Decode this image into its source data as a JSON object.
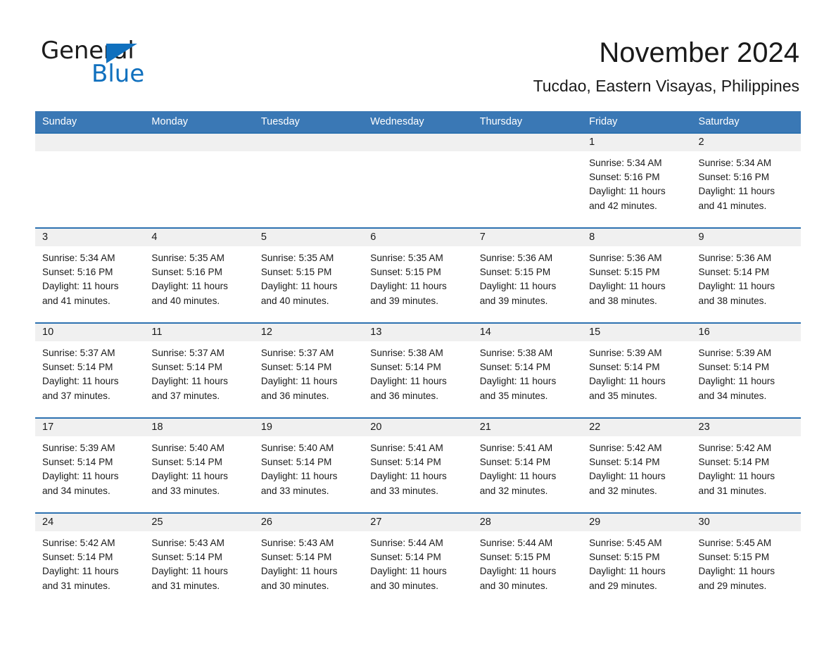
{
  "brand": {
    "name_part1": "General",
    "name_part2": "Blue",
    "logo_icon": "triangle-logo",
    "accent_color": "#1070be"
  },
  "header": {
    "month_title": "November 2024",
    "location": "Tucdao, Eastern Visayas, Philippines"
  },
  "colors": {
    "header_blue": "#3a78b5",
    "row_divider_blue": "#2d72b0",
    "daynum_strip": "#f0f0f0"
  },
  "weekdays": [
    "Sunday",
    "Monday",
    "Tuesday",
    "Wednesday",
    "Thursday",
    "Friday",
    "Saturday"
  ],
  "weeks": [
    [
      {
        "day": "",
        "sunrise": "",
        "sunset": "",
        "daylight1": "",
        "daylight2": ""
      },
      {
        "day": "",
        "sunrise": "",
        "sunset": "",
        "daylight1": "",
        "daylight2": ""
      },
      {
        "day": "",
        "sunrise": "",
        "sunset": "",
        "daylight1": "",
        "daylight2": ""
      },
      {
        "day": "",
        "sunrise": "",
        "sunset": "",
        "daylight1": "",
        "daylight2": ""
      },
      {
        "day": "",
        "sunrise": "",
        "sunset": "",
        "daylight1": "",
        "daylight2": ""
      },
      {
        "day": "1",
        "sunrise": "Sunrise: 5:34 AM",
        "sunset": "Sunset: 5:16 PM",
        "daylight1": "Daylight: 11 hours",
        "daylight2": "and 42 minutes."
      },
      {
        "day": "2",
        "sunrise": "Sunrise: 5:34 AM",
        "sunset": "Sunset: 5:16 PM",
        "daylight1": "Daylight: 11 hours",
        "daylight2": "and 41 minutes."
      }
    ],
    [
      {
        "day": "3",
        "sunrise": "Sunrise: 5:34 AM",
        "sunset": "Sunset: 5:16 PM",
        "daylight1": "Daylight: 11 hours",
        "daylight2": "and 41 minutes."
      },
      {
        "day": "4",
        "sunrise": "Sunrise: 5:35 AM",
        "sunset": "Sunset: 5:16 PM",
        "daylight1": "Daylight: 11 hours",
        "daylight2": "and 40 minutes."
      },
      {
        "day": "5",
        "sunrise": "Sunrise: 5:35 AM",
        "sunset": "Sunset: 5:15 PM",
        "daylight1": "Daylight: 11 hours",
        "daylight2": "and 40 minutes."
      },
      {
        "day": "6",
        "sunrise": "Sunrise: 5:35 AM",
        "sunset": "Sunset: 5:15 PM",
        "daylight1": "Daylight: 11 hours",
        "daylight2": "and 39 minutes."
      },
      {
        "day": "7",
        "sunrise": "Sunrise: 5:36 AM",
        "sunset": "Sunset: 5:15 PM",
        "daylight1": "Daylight: 11 hours",
        "daylight2": "and 39 minutes."
      },
      {
        "day": "8",
        "sunrise": "Sunrise: 5:36 AM",
        "sunset": "Sunset: 5:15 PM",
        "daylight1": "Daylight: 11 hours",
        "daylight2": "and 38 minutes."
      },
      {
        "day": "9",
        "sunrise": "Sunrise: 5:36 AM",
        "sunset": "Sunset: 5:14 PM",
        "daylight1": "Daylight: 11 hours",
        "daylight2": "and 38 minutes."
      }
    ],
    [
      {
        "day": "10",
        "sunrise": "Sunrise: 5:37 AM",
        "sunset": "Sunset: 5:14 PM",
        "daylight1": "Daylight: 11 hours",
        "daylight2": "and 37 minutes."
      },
      {
        "day": "11",
        "sunrise": "Sunrise: 5:37 AM",
        "sunset": "Sunset: 5:14 PM",
        "daylight1": "Daylight: 11 hours",
        "daylight2": "and 37 minutes."
      },
      {
        "day": "12",
        "sunrise": "Sunrise: 5:37 AM",
        "sunset": "Sunset: 5:14 PM",
        "daylight1": "Daylight: 11 hours",
        "daylight2": "and 36 minutes."
      },
      {
        "day": "13",
        "sunrise": "Sunrise: 5:38 AM",
        "sunset": "Sunset: 5:14 PM",
        "daylight1": "Daylight: 11 hours",
        "daylight2": "and 36 minutes."
      },
      {
        "day": "14",
        "sunrise": "Sunrise: 5:38 AM",
        "sunset": "Sunset: 5:14 PM",
        "daylight1": "Daylight: 11 hours",
        "daylight2": "and 35 minutes."
      },
      {
        "day": "15",
        "sunrise": "Sunrise: 5:39 AM",
        "sunset": "Sunset: 5:14 PM",
        "daylight1": "Daylight: 11 hours",
        "daylight2": "and 35 minutes."
      },
      {
        "day": "16",
        "sunrise": "Sunrise: 5:39 AM",
        "sunset": "Sunset: 5:14 PM",
        "daylight1": "Daylight: 11 hours",
        "daylight2": "and 34 minutes."
      }
    ],
    [
      {
        "day": "17",
        "sunrise": "Sunrise: 5:39 AM",
        "sunset": "Sunset: 5:14 PM",
        "daylight1": "Daylight: 11 hours",
        "daylight2": "and 34 minutes."
      },
      {
        "day": "18",
        "sunrise": "Sunrise: 5:40 AM",
        "sunset": "Sunset: 5:14 PM",
        "daylight1": "Daylight: 11 hours",
        "daylight2": "and 33 minutes."
      },
      {
        "day": "19",
        "sunrise": "Sunrise: 5:40 AM",
        "sunset": "Sunset: 5:14 PM",
        "daylight1": "Daylight: 11 hours",
        "daylight2": "and 33 minutes."
      },
      {
        "day": "20",
        "sunrise": "Sunrise: 5:41 AM",
        "sunset": "Sunset: 5:14 PM",
        "daylight1": "Daylight: 11 hours",
        "daylight2": "and 33 minutes."
      },
      {
        "day": "21",
        "sunrise": "Sunrise: 5:41 AM",
        "sunset": "Sunset: 5:14 PM",
        "daylight1": "Daylight: 11 hours",
        "daylight2": "and 32 minutes."
      },
      {
        "day": "22",
        "sunrise": "Sunrise: 5:42 AM",
        "sunset": "Sunset: 5:14 PM",
        "daylight1": "Daylight: 11 hours",
        "daylight2": "and 32 minutes."
      },
      {
        "day": "23",
        "sunrise": "Sunrise: 5:42 AM",
        "sunset": "Sunset: 5:14 PM",
        "daylight1": "Daylight: 11 hours",
        "daylight2": "and 31 minutes."
      }
    ],
    [
      {
        "day": "24",
        "sunrise": "Sunrise: 5:42 AM",
        "sunset": "Sunset: 5:14 PM",
        "daylight1": "Daylight: 11 hours",
        "daylight2": "and 31 minutes."
      },
      {
        "day": "25",
        "sunrise": "Sunrise: 5:43 AM",
        "sunset": "Sunset: 5:14 PM",
        "daylight1": "Daylight: 11 hours",
        "daylight2": "and 31 minutes."
      },
      {
        "day": "26",
        "sunrise": "Sunrise: 5:43 AM",
        "sunset": "Sunset: 5:14 PM",
        "daylight1": "Daylight: 11 hours",
        "daylight2": "and 30 minutes."
      },
      {
        "day": "27",
        "sunrise": "Sunrise: 5:44 AM",
        "sunset": "Sunset: 5:14 PM",
        "daylight1": "Daylight: 11 hours",
        "daylight2": "and 30 minutes."
      },
      {
        "day": "28",
        "sunrise": "Sunrise: 5:44 AM",
        "sunset": "Sunset: 5:15 PM",
        "daylight1": "Daylight: 11 hours",
        "daylight2": "and 30 minutes."
      },
      {
        "day": "29",
        "sunrise": "Sunrise: 5:45 AM",
        "sunset": "Sunset: 5:15 PM",
        "daylight1": "Daylight: 11 hours",
        "daylight2": "and 29 minutes."
      },
      {
        "day": "30",
        "sunrise": "Sunrise: 5:45 AM",
        "sunset": "Sunset: 5:15 PM",
        "daylight1": "Daylight: 11 hours",
        "daylight2": "and 29 minutes."
      }
    ]
  ]
}
